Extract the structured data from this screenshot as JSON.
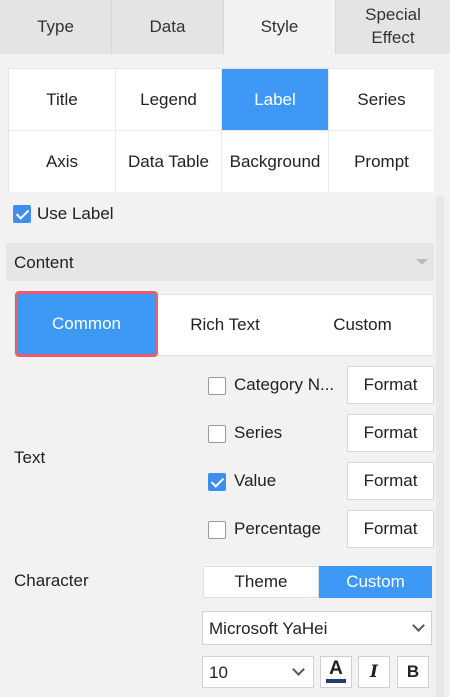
{
  "top_tabs": [
    {
      "label": "Type",
      "active": false
    },
    {
      "label": "Data",
      "active": false
    },
    {
      "label": "Style",
      "active": true
    },
    {
      "label": "Special Effect",
      "active": false
    }
  ],
  "sub_tabs_row1": [
    "Title",
    "Legend",
    "Label",
    "Series"
  ],
  "sub_tabs_row2": [
    "Axis",
    "Data Table",
    "Background",
    "Prompt"
  ],
  "active_sub_tab": "Label",
  "use_label": {
    "label": "Use Label",
    "checked": true
  },
  "section": {
    "title": "Content"
  },
  "content_modes": {
    "common": "Common",
    "rich_text": "Rich Text",
    "custom": "Custom",
    "active": "Common"
  },
  "text_group": {
    "label": "Text",
    "items": [
      {
        "label": "Category N...",
        "checked": false,
        "format_label": "Format"
      },
      {
        "label": "Series",
        "checked": false,
        "format_label": "Format"
      },
      {
        "label": "Value",
        "checked": true,
        "format_label": "Format"
      },
      {
        "label": "Percentage",
        "checked": false,
        "format_label": "Format"
      }
    ]
  },
  "character": {
    "label": "Character",
    "theme_label": "Theme",
    "custom_label": "Custom",
    "active": "Custom",
    "font_family": "Microsoft YaHei",
    "font_size": "10",
    "font_color_glyph": "A",
    "italic_glyph": "I",
    "bold_glyph": "B"
  },
  "colors": {
    "accent": "#3d99f5",
    "highlight": "#f05a73",
    "font_color_bar": "#1f3f6b"
  }
}
